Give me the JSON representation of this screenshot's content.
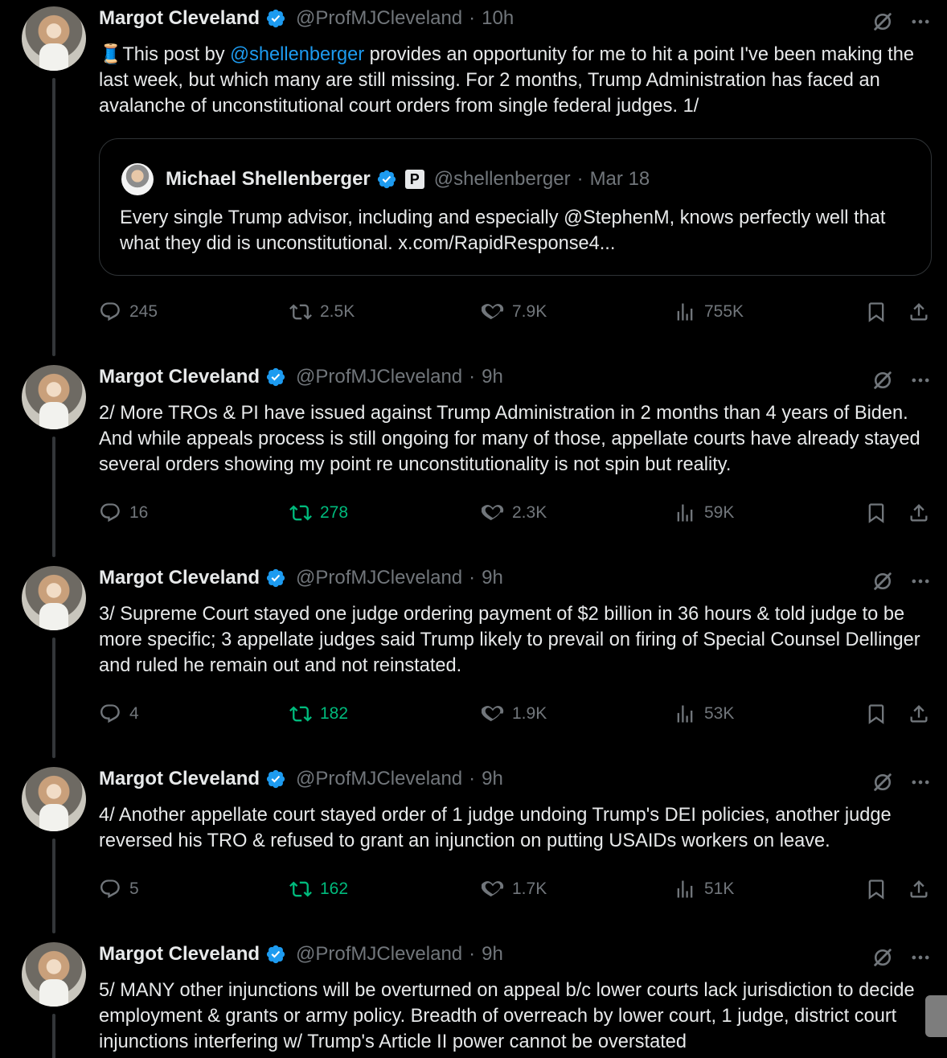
{
  "colors": {
    "background": "#000000",
    "text": "#e7e9ea",
    "muted": "#71767b",
    "link": "#1d9bf0",
    "verified": "#1d9bf0",
    "retweet_active": "#00ba7c",
    "border": "#2f3336"
  },
  "tweets": [
    {
      "name": "Margot Cleveland",
      "handle": "@ProfMJCleveland",
      "separator": "·",
      "time": "10h",
      "emoji": "🧵",
      "text_before_mention": "This post by ",
      "mention": "@shellenberger",
      "text_after_mention": " provides an opportunity for me to hit a point I've been making the last week, but which many are still missing. For 2 months, Trump Administration has faced an avalanche of unconstitutional court orders from single federal judges. 1/",
      "quote": {
        "name": "Michael Shellenberger",
        "badge": "P",
        "handle": "@shellenberger",
        "separator": "·",
        "time": "Mar 18",
        "text": "Every single Trump advisor, including and especially @StephenM, knows perfectly well that what they did is unconstitutional. x.com/RapidResponse4..."
      },
      "replies": "245",
      "retweets": "2.5K",
      "likes": "7.9K",
      "views": "755K",
      "retweeted": false
    },
    {
      "name": "Margot Cleveland",
      "handle": "@ProfMJCleveland",
      "separator": "·",
      "time": "9h",
      "text": "2/ More TROs & PI have issued against Trump Administration in 2 months than 4 years of Biden. And while appeals process is still ongoing for many of those, appellate courts have already stayed several orders showing my point re unconstitutionality is not spin but reality.",
      "replies": "16",
      "retweets": "278",
      "likes": "2.3K",
      "views": "59K",
      "retweeted": true
    },
    {
      "name": "Margot Cleveland",
      "handle": "@ProfMJCleveland",
      "separator": "·",
      "time": "9h",
      "text": "3/ Supreme Court stayed one judge ordering payment of $2 billion in 36 hours & told judge to be more specific; 3 appellate judges said Trump likely to prevail on firing of  Special Counsel Dellinger and ruled he remain out and not reinstated.",
      "replies": "4",
      "retweets": "182",
      "likes": "1.9K",
      "views": "53K",
      "retweeted": true
    },
    {
      "name": "Margot Cleveland",
      "handle": "@ProfMJCleveland",
      "separator": "·",
      "time": "9h",
      "text": "4/ Another appellate court stayed order of 1 judge undoing Trump's DEI policies, another judge reversed his TRO & refused to grant an injunction on putting USAIDs workers on leave.",
      "replies": "5",
      "retweets": "162",
      "likes": "1.7K",
      "views": "51K",
      "retweeted": true
    },
    {
      "name": "Margot Cleveland",
      "handle": "@ProfMJCleveland",
      "separator": "·",
      "time": "9h",
      "text": "5/ MANY other injunctions will be overturned on appeal b/c lower courts lack jurisdiction to decide employment & grants or army policy. Breadth of overreach by  lower court, 1 judge, district court injunctions interfering w/ Trump's Article II power cannot be overstated"
    }
  ]
}
